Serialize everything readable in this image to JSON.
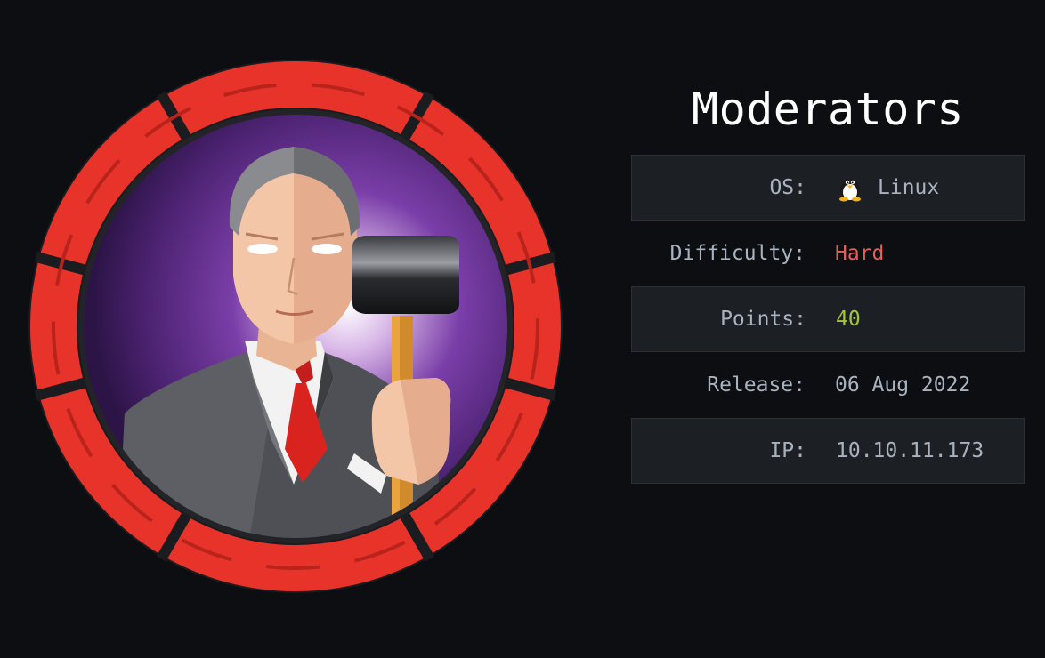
{
  "machine": {
    "name": "Moderators",
    "avatar_icon": "moderator-with-hammer-avatar"
  },
  "info": [
    {
      "label": "OS:",
      "value": "Linux",
      "icon": "tux-penguin-icon",
      "color": "#a9b2bf"
    },
    {
      "label": "Difficulty:",
      "value": "Hard",
      "color": "#e35f5a"
    },
    {
      "label": "Points:",
      "value": "40",
      "color": "#a4c43b"
    },
    {
      "label": "Release:",
      "value": "06 Aug 2022",
      "color": "#a9b2bf"
    },
    {
      "label": "IP:",
      "value": "10.10.11.173",
      "color": "#a9b2bf"
    }
  ],
  "colors": {
    "background": "#0c0e11",
    "row_shaded": "#1c1f24",
    "ring_red": "#e8332a",
    "avatar_purple": "#5b2a8c"
  }
}
